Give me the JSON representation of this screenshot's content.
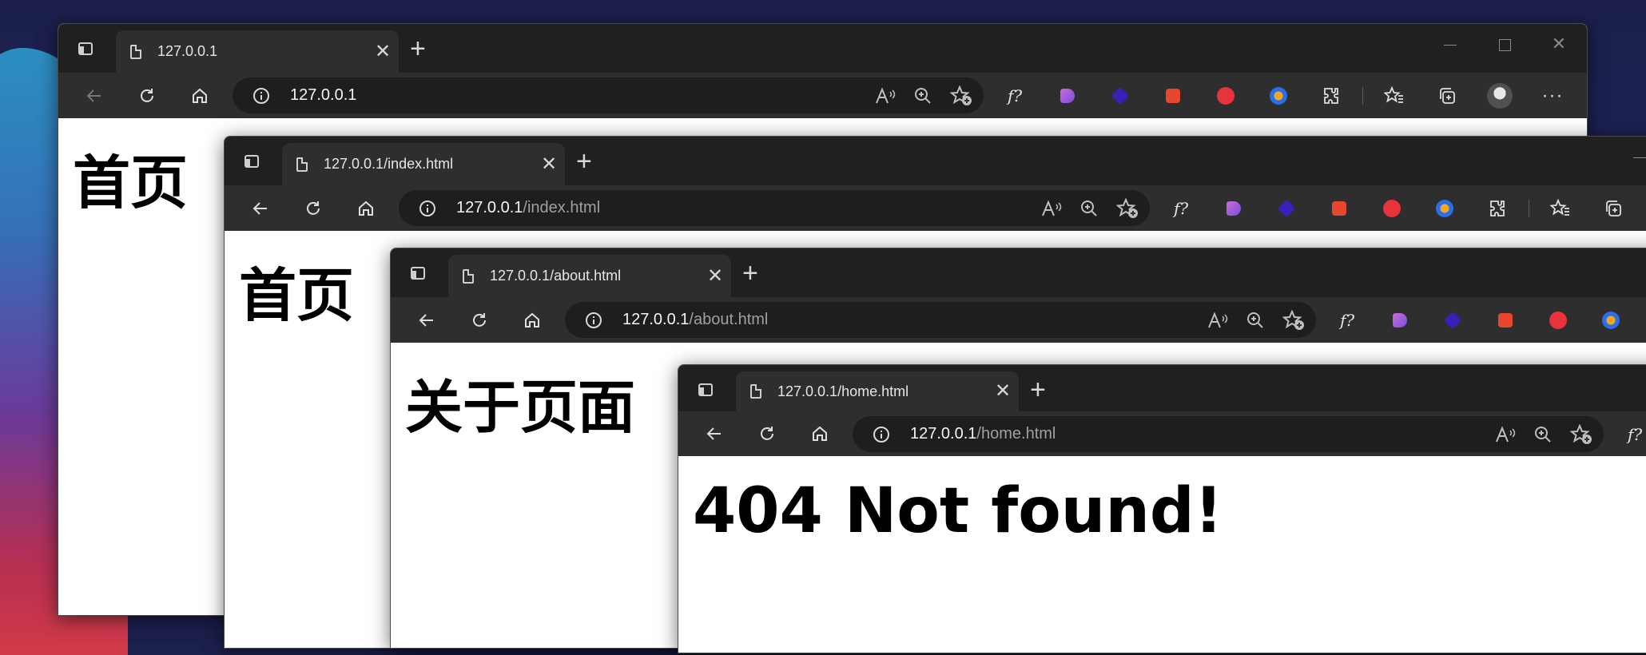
{
  "colors": {
    "titlebar": "#202020",
    "toolbar": "#2e2e2e",
    "address_bg": "#1e1e1e",
    "page_bg": "#ffffff"
  },
  "windows": [
    {
      "tab_title": "127.0.0.1",
      "url_host": "127.0.0.1",
      "url_path": "",
      "heading": "首页"
    },
    {
      "tab_title": "127.0.0.1/index.html",
      "url_host": "127.0.0.1",
      "url_path": "/index.html",
      "heading": "首页"
    },
    {
      "tab_title": "127.0.0.1/about.html",
      "url_host": "127.0.0.1",
      "url_path": "/about.html",
      "heading": "关于页面"
    },
    {
      "tab_title": "127.0.0.1/home.html",
      "url_host": "127.0.0.1",
      "url_path": "/home.html",
      "heading": "404 Not found!"
    }
  ],
  "toolbar_labels": {
    "favorites_extension": "f?"
  },
  "icons": [
    "back-icon",
    "refresh-icon",
    "home-icon",
    "info-icon",
    "read-aloud-icon",
    "zoom-icon",
    "favorite-add-icon",
    "extensions-icon",
    "favorites-icon",
    "collections-icon",
    "more-icon"
  ]
}
